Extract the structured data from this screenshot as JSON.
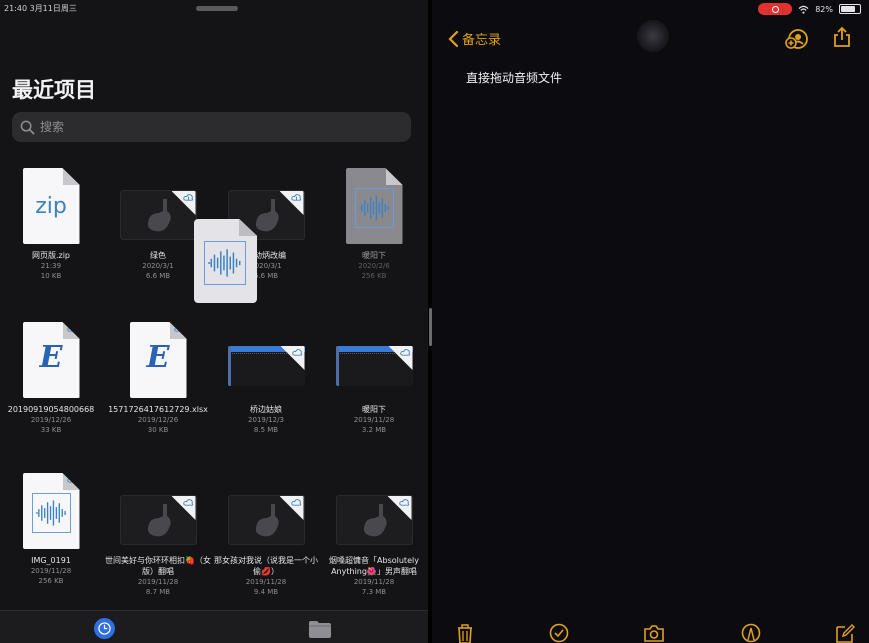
{
  "status": {
    "time_date": "21:40  3月11日周三",
    "battery": "82%"
  },
  "files_app": {
    "title": "最近项目",
    "search_placeholder": "搜索",
    "files": [
      {
        "name": "网页版.zip",
        "date": "21:39",
        "size": "10 KB",
        "type": "zip"
      },
      {
        "name": "绿色",
        "date": "2020/3/1",
        "size": "6.6 MB",
        "type": "garageband"
      },
      {
        "name": "声动炳改编",
        "date": "2020/3/1",
        "size": "6.6 MB",
        "type": "garageband"
      },
      {
        "name": "暖阳下",
        "date": "2020/2/6",
        "size": "256 KB",
        "type": "audio-gray"
      },
      {
        "name": "20190919054800668",
        "date": "2019/12/26",
        "size": "33 KB",
        "type": "excel"
      },
      {
        "name": "1571726417612729.xlsx",
        "date": "2019/12/26",
        "size": "30 KB",
        "type": "excel"
      },
      {
        "name": "桥边姑娘",
        "date": "2019/12/3",
        "size": "8.5 MB",
        "type": "project"
      },
      {
        "name": "暖阳下",
        "date": "2019/11/28",
        "size": "3.2 MB",
        "type": "project"
      },
      {
        "name": "IMG_0191",
        "date": "2019/11/28",
        "size": "256 KB",
        "type": "audio"
      },
      {
        "name": "世间美好与你环环相扣🍓（女版）翻唱",
        "date": "2019/11/28",
        "size": "8.7 MB",
        "type": "garageband"
      },
      {
        "name": "那女孩对我说（说我是一个小偷💋）",
        "date": "2019/11/28",
        "size": "9.4 MB",
        "type": "garageband"
      },
      {
        "name": "烟嗓超慵音「Absolutely Anything🌺」男声翻唱",
        "date": "2019/11/28",
        "size": "7.3 MB",
        "type": "garageband"
      }
    ]
  },
  "notes_app": {
    "back_label": "备忘录",
    "note_body": "直接拖动音频文件"
  },
  "colors": {
    "accent": "#e0a11b",
    "tab_active": "#2f6fe0",
    "record": "#e0332f"
  }
}
